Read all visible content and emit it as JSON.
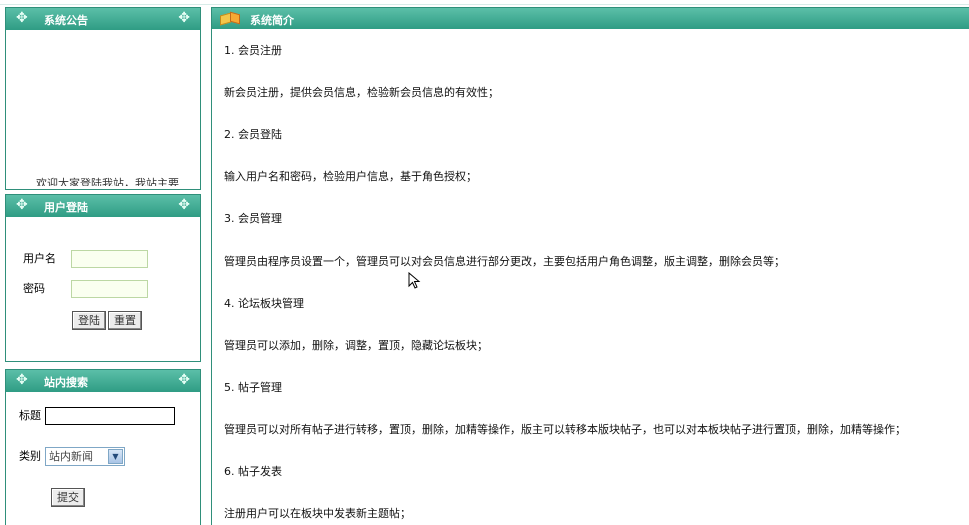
{
  "panels": {
    "announce": {
      "title": "系统公告",
      "marquee": "欢迎大家登陆我站，我站主要"
    },
    "login": {
      "title": "用户登陆",
      "username_label": "用户名",
      "password_label": "密码",
      "login_btn": "登陆",
      "reset_btn": "重置"
    },
    "search": {
      "title": "站内搜索",
      "title_label": "标题",
      "category_label": "类别",
      "category_value": "站内新闻",
      "submit_btn": "提交"
    }
  },
  "main": {
    "title": "系统简介",
    "lines": [
      "1. 会员注册",
      "新会员注册，提供会员信息，检验新会员信息的有效性；",
      "2. 会员登陆",
      "输入用户名和密码，检验用户信息，基于角色授权；",
      "3. 会员管理",
      "管理员由程序员设置一个，管理员可以对会员信息进行部分更改，主要包括用户角色调整，版主调整，删除会员等；",
      "4. 论坛板块管理",
      "管理员可以添加，删除，调整，置顶，隐藏论坛板块；",
      "5. 帖子管理",
      "管理员可以对所有帖子进行转移，置顶，删除，加精等操作，版主可以转移本版块帖子，也可以对本板块帖子进行置顶，删除，加精等操作；",
      "6. 帖子发表",
      "注册用户可以在板块中发表新主题帖；"
    ]
  },
  "colors": {
    "header_top": "#5bbfa8",
    "header_bottom": "#2f9c84",
    "border": "#2f8f7a"
  }
}
